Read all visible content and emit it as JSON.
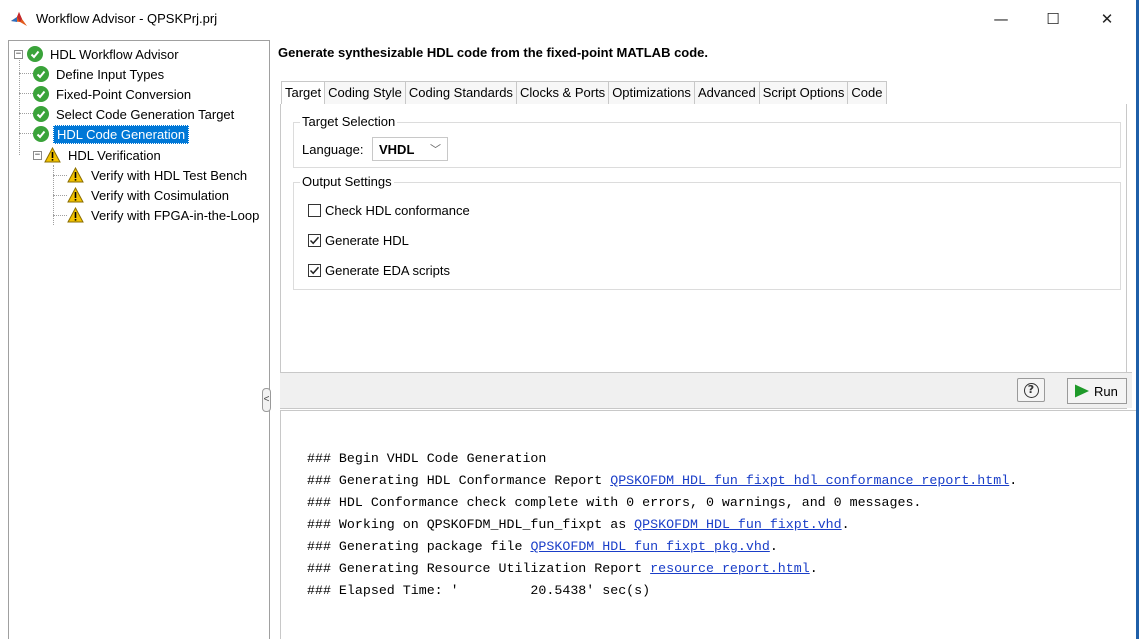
{
  "window": {
    "title": "Workflow Advisor - QPSKPrj.prj",
    "min_glyph": "—",
    "max_glyph": "☐",
    "close_glyph": "✕",
    "app_icon": "matlab-logo-icon"
  },
  "tree": {
    "items": [
      {
        "label": "HDL Workflow Advisor",
        "status": "ok",
        "expander": "⊟"
      },
      {
        "label": "Define Input Types",
        "status": "ok"
      },
      {
        "label": "Fixed-Point Conversion",
        "status": "ok"
      },
      {
        "label": "Select Code Generation Target",
        "status": "ok"
      },
      {
        "label": "HDL Code Generation",
        "status": "ok",
        "selected": true
      },
      {
        "label": "HDL Verification",
        "status": "warning",
        "expander": "⊟"
      },
      {
        "label": "Verify with HDL Test Bench",
        "status": "warning"
      },
      {
        "label": "Verify with Cosimulation",
        "status": "warning"
      },
      {
        "label": "Verify with FPGA-in-the-Loop",
        "status": "warning"
      }
    ],
    "collapse_glyph": "<"
  },
  "main": {
    "heading": "Generate synthesizable HDL code from the fixed-point MATLAB code.",
    "tabs": [
      "Target",
      "Coding Style",
      "Coding Standards",
      "Clocks & Ports",
      "Optimizations",
      "Advanced",
      "Script Options",
      "Code"
    ],
    "active_tab": "Target",
    "target_selection": {
      "title": "Target Selection",
      "language_label": "Language:",
      "language_value": "VHDL"
    },
    "output_settings": {
      "title": "Output Settings",
      "options": [
        {
          "label": "Check HDL conformance",
          "checked": false
        },
        {
          "label": "Generate HDL",
          "checked": true
        },
        {
          "label": "Generate EDA scripts",
          "checked": true
        }
      ]
    },
    "toolbar": {
      "help_glyph": "?",
      "run_label": "Run"
    }
  },
  "log": {
    "lines": [
      {
        "text": "### Begin VHDL Code Generation",
        "link": "",
        "suffix": ""
      },
      {
        "text": "### Generating HDL Conformance Report ",
        "link": "QPSKOFDM_HDL_fun_fixpt_hdl_conformance_report.html",
        "suffix": "."
      },
      {
        "text": "### HDL Conformance check complete with 0 errors, 0 warnings, and 0 messages.",
        "link": "",
        "suffix": ""
      },
      {
        "text": "### Working on QPSKOFDM_HDL_fun_fixpt as ",
        "link": "QPSKOFDM_HDL_fun_fixpt.vhd",
        "suffix": "."
      },
      {
        "text": "### Generating package file ",
        "link": "QPSKOFDM_HDL_fun_fixpt_pkg.vhd",
        "suffix": "."
      },
      {
        "text": "### Generating Resource Utilization Report ",
        "link": "resource_report.html",
        "suffix": "."
      },
      {
        "text": "### Elapsed Time: '         20.5438' sec(s)",
        "link": "",
        "suffix": ""
      }
    ]
  },
  "colors": {
    "ok": "#3aa33a",
    "warning": "#f2c200",
    "selection": "#0078d7",
    "link": "#1a3ec8",
    "run_arrow": "#1f9a2a"
  }
}
